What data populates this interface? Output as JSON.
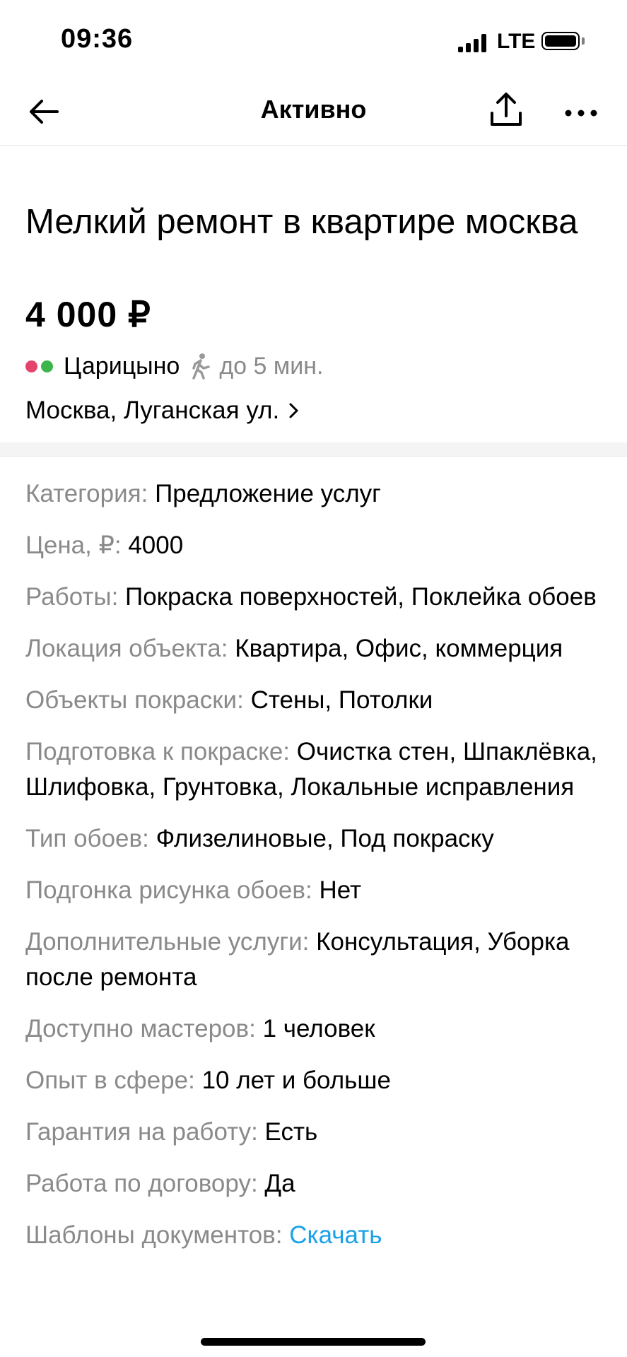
{
  "status_bar": {
    "time": "09:36",
    "network": "LTE"
  },
  "nav": {
    "title": "Активно",
    "back_icon": "arrow-left-icon",
    "share_icon": "share-icon",
    "more_icon": "more-horizontal-icon"
  },
  "listing": {
    "title": "Мелкий ремонт в квартире москва",
    "price": "4 000 ₽",
    "metro": {
      "station": "Царицыно",
      "walk_time": "до 5 мин.",
      "line_colors": [
        "#e4436b",
        "#3cb54a"
      ]
    },
    "address": "Москва, Луганская ул."
  },
  "params": [
    {
      "label": "Категория:",
      "value": "Предложение услуг"
    },
    {
      "label": "Цена, ₽:",
      "value": "4000"
    },
    {
      "label": "Работы:",
      "value": "Покраска поверхностей, Поклейка обоев"
    },
    {
      "label": "Локация объекта:",
      "value": "Квартира, Офис, коммерция"
    },
    {
      "label": "Объекты покраски:",
      "value": "Стены, Потолки"
    },
    {
      "label": "Подготовка к покраске:",
      "value": "Очистка стен, Шпаклёвка, Шлифовка, Грунтовка, Локальные исправления"
    },
    {
      "label": "Тип обоев:",
      "value": "Флизелиновые, Под покраску"
    },
    {
      "label": "Подгонка рисунка обоев:",
      "value": "Нет"
    },
    {
      "label": "Дополнительные услуги:",
      "value": "Консультация, Уборка после ремонта"
    },
    {
      "label": "Доступно мастеров:",
      "value": "1 человек"
    },
    {
      "label": "Опыт в сфере:",
      "value": "10 лет и больше"
    },
    {
      "label": "Гарантия на работу:",
      "value": "Есть"
    },
    {
      "label": "Работа по договору:",
      "value": "Да"
    },
    {
      "label": "Шаблоны документов:",
      "value": "Скачать"
    }
  ],
  "colors": {
    "label_gray": "#8a8a8a",
    "link_blue": "#1aa2e8"
  }
}
